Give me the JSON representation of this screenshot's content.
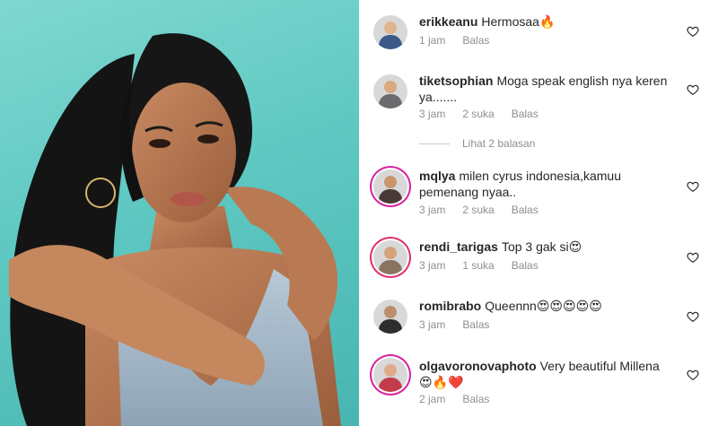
{
  "post": {
    "comments": [
      {
        "username": "erikkeanu",
        "text": "Hermosaa🔥",
        "time": "1 jam",
        "likes": "",
        "reply": "Balas",
        "avatar_color": "#3b5a8a"
      },
      {
        "username": "tiketsophian",
        "text": "Moga  speak english nya keren ya.......",
        "time": "3 jam",
        "likes": "2 suka",
        "reply": "Balas",
        "avatar_color": "#6b6b70"
      },
      {
        "username": "mqlya",
        "text": "milen cyrus indonesia,kamuu pemenang nyaa..",
        "time": "3 jam",
        "likes": "2 suka",
        "reply": "Balas",
        "avatar_color": "#4a3a36"
      },
      {
        "username": "rendi_tarigas",
        "text": "Top 3 gak si😍",
        "time": "3 jam",
        "likes": "1 suka",
        "reply": "Balas",
        "avatar_color": "#8a7460"
      },
      {
        "username": "romibrabo",
        "text": "Queennn😍😍😍😍😍",
        "time": "3 jam",
        "likes": "",
        "reply": "Balas",
        "avatar_color": "#2e2e2e"
      },
      {
        "username": "olgavoronovaphoto",
        "text": "Very beautiful Millena 😍🔥❤️",
        "time": "2 jam",
        "likes": "",
        "reply": "Balas",
        "avatar_color": "#c23b4a"
      }
    ],
    "view_replies": "Lihat 2 balasan"
  }
}
